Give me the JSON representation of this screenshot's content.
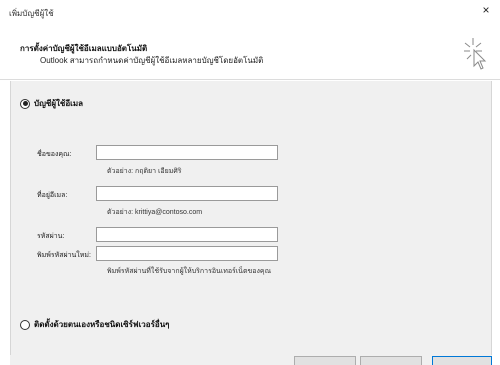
{
  "window": {
    "title": "เพิ่มบัญชีผู้ใช้",
    "close_label": "×"
  },
  "header": {
    "title": "การตั้งค่าบัญชีผู้ใช้อีเมลแบบอัตโนมัติ",
    "subtitle": "Outlook สามารถกำหนดค่าบัญชีผู้ใช้อีเมลหลายบัญชีโดยอัตโนมัติ",
    "icon": "sparkle-cursor-icon"
  },
  "options": {
    "email_account": {
      "label": "บัญชีผู้ใช้อีเมล",
      "selected": true
    },
    "manual_setup": {
      "label": "ติดตั้งด้วยตนเองหรือชนิดเซิร์ฟเวอร์อื่นๆ",
      "selected": false
    }
  },
  "form": {
    "name": {
      "label": "ชื่อของคุณ:",
      "value": "",
      "hint": "ตัวอย่าง: กฤติยา เอียมศิริ"
    },
    "email": {
      "label": "ที่อยู่อีเมล:",
      "value": "",
      "hint": "ตัวอย่าง: krittiya@contoso.com"
    },
    "password": {
      "label": "รหัสผ่าน:",
      "value": ""
    },
    "retype": {
      "label": "พิมพ์รหัสผ่านใหม่:",
      "value": "",
      "hint": "พิมพ์รหัสผ่านที่ใช้รับจากผู้ให้บริการอินเทอร์เน็ตของคุณ"
    }
  },
  "colors": {
    "accent": "#0078d7",
    "panel": "#f0f0f0"
  }
}
